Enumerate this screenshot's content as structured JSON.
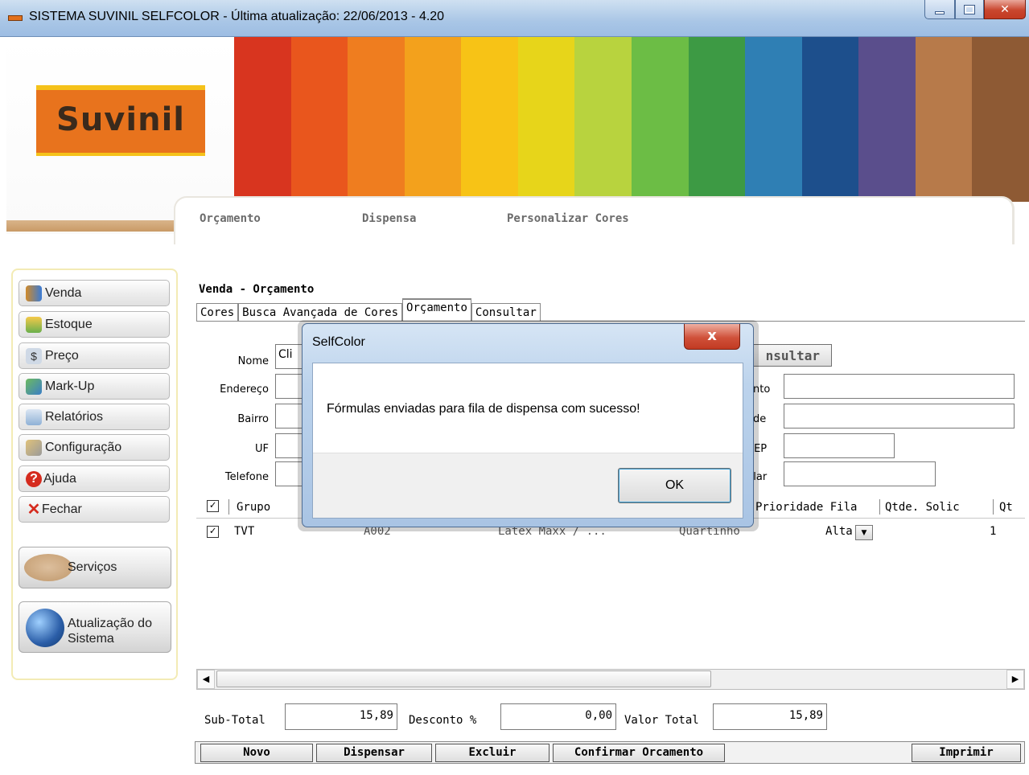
{
  "window": {
    "title": "SISTEMA SUVINIL SELFCOLOR - Última atualização: 22/06/2013 - 4.20"
  },
  "brand": {
    "logo_text": "Suvinil"
  },
  "banner_colors": [
    "#d8351f",
    "#e9561d",
    "#ef7d1f",
    "#f3a11c",
    "#f7c316",
    "#e7d51a",
    "#b8d33e",
    "#6cbd45",
    "#3d9a44",
    "#2f7fb4",
    "#1d4f8c",
    "#5a4e8c",
    "#b77a4a",
    "#8e5a34"
  ],
  "top_menu": [
    "Orçamento",
    "Dispensa",
    "Personalizar Cores"
  ],
  "sidebar": {
    "items": [
      {
        "label": "Venda",
        "icon": "users-icon"
      },
      {
        "label": "Estoque",
        "icon": "box-icon"
      },
      {
        "label": "Preço",
        "icon": "price-icon"
      },
      {
        "label": "Mark-Up",
        "icon": "markup-icon"
      },
      {
        "label": "Relatórios",
        "icon": "reports-icon"
      },
      {
        "label": "Configuração",
        "icon": "wrench-icon"
      },
      {
        "label": "Ajuda",
        "icon": "help-icon"
      },
      {
        "label": "Fechar",
        "icon": "close-x-icon"
      }
    ],
    "servicos": "Serviços",
    "atualizacao_line1": "Atualização do",
    "atualizacao_line2": "Sistema"
  },
  "form": {
    "title": "Venda - Orçamento",
    "tabs": [
      "Cores",
      "Busca Avançada de Cores",
      "Orçamento",
      "Consultar"
    ],
    "active_tab": "Orçamento",
    "labels": {
      "nome": "Nome",
      "endereco": "Endereço",
      "bairro": "Bairro",
      "uf": "UF",
      "telefone": "Telefone"
    },
    "right_labels": {
      "complemento": "ento",
      "cidade": "ade",
      "cep": "CEP",
      "celular": "ular"
    },
    "nome_value": "Cli",
    "consultar_button": "nsultar"
  },
  "grid": {
    "headers": {
      "grupo": "Grupo",
      "prioridade": "Prioridade Fila",
      "qtde": "Qtde. Solic",
      "qt": "Qt"
    },
    "row": {
      "grupo": "TVT",
      "codigo": "A002",
      "produto": "Látex Maxx / ...",
      "ambiente": "Quartinho",
      "prioridade": "Alta",
      "qtde": "1"
    }
  },
  "totals": {
    "subtotal_label": "Sub-Total",
    "subtotal": "15,89",
    "desconto_label": "Desconto %",
    "desconto": "0,00",
    "valor_total_label": "Valor Total",
    "valor_total": "15,89"
  },
  "buttons": {
    "novo": "Novo",
    "dispensar": "Dispensar",
    "excluir": "Excluir",
    "confirmar": "Confirmar Orcamento",
    "imprimir": "Imprimir"
  },
  "dialog": {
    "title": "SelfColor",
    "message": "Fórmulas enviadas para fila de dispensa com sucesso!",
    "ok": "OK",
    "close_glyph": "x"
  }
}
